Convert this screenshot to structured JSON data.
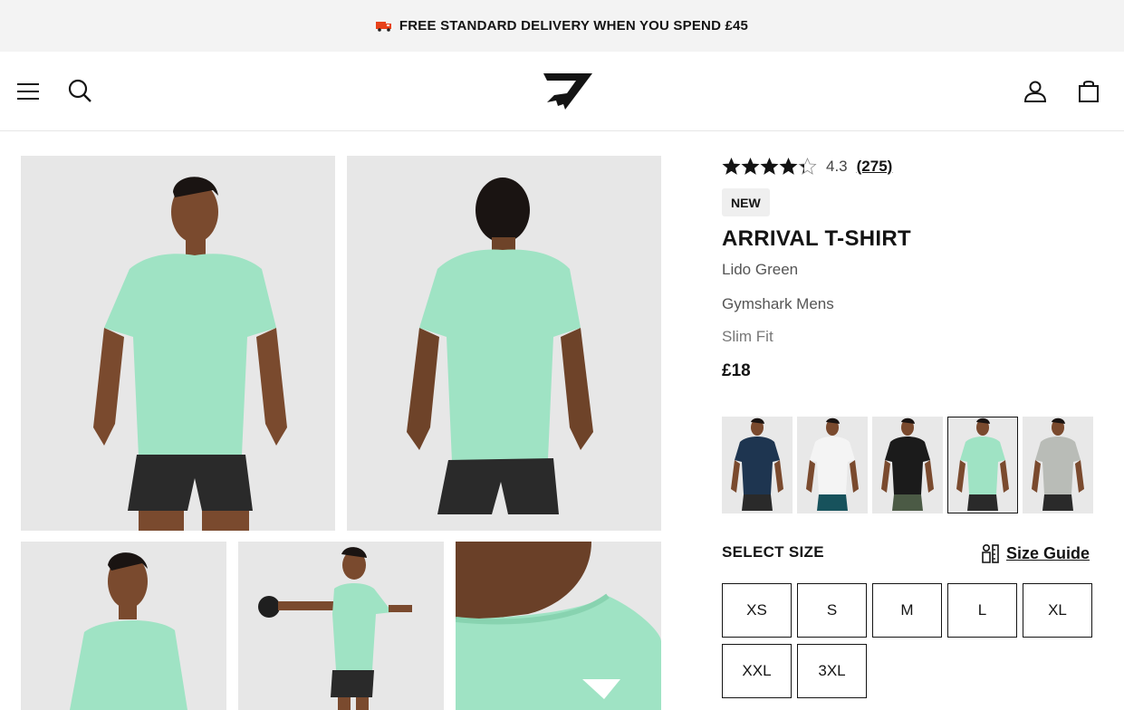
{
  "promo": {
    "text": "FREE STANDARD DELIVERY WHEN YOU SPEND £45",
    "icon": "delivery-truck-icon"
  },
  "header": {
    "icons": [
      "menu-icon",
      "search-icon",
      "gymshark-logo",
      "account-icon",
      "shopping-bag-icon"
    ]
  },
  "gallery": {
    "images": [
      {
        "name": "model-front-view"
      },
      {
        "name": "model-back-view"
      },
      {
        "name": "model-side-view"
      },
      {
        "name": "model-kettlebell-view"
      },
      {
        "name": "collar-closeup-view"
      }
    ]
  },
  "product": {
    "rating": "4.3",
    "rating_value": 4.3,
    "review_count": "(275)",
    "badge": "NEW",
    "title": "ARRIVAL T-SHIRT",
    "colour": "Lido Green",
    "brand": "Gymshark Mens",
    "fit": "Slim Fit",
    "price": "£18"
  },
  "swatches": [
    {
      "name": "navy",
      "shirt": "#1e3550",
      "shorts": "#2a2a2a",
      "selected": false
    },
    {
      "name": "white",
      "shirt": "#f4f4f4",
      "shorts": "#17525c",
      "selected": false
    },
    {
      "name": "black",
      "shirt": "#1b1b1b",
      "shorts": "#4b5a45",
      "selected": false
    },
    {
      "name": "lido-green",
      "shirt": "#9fe3c4",
      "shorts": "#2a2a2a",
      "selected": true
    },
    {
      "name": "grey",
      "shirt": "#b9bcb7",
      "shorts": "#2a2a2a",
      "selected": false
    }
  ],
  "sizes": {
    "heading": "SELECT SIZE",
    "guide_label": "Size Guide",
    "options": [
      "XS",
      "S",
      "M",
      "L",
      "XL",
      "XXL",
      "3XL"
    ]
  },
  "colors": {
    "shirt_green": "#9fe3c4",
    "bg_grey": "#e7e7e7",
    "text": "#141414"
  }
}
